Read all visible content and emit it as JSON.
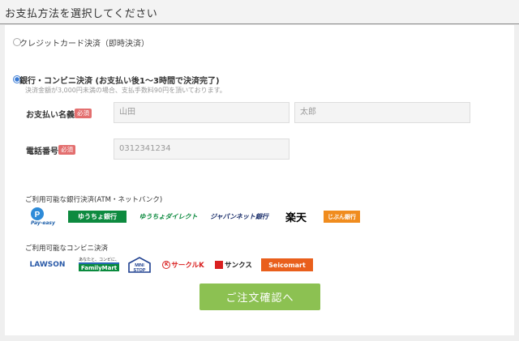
{
  "header": {
    "title": "お支払方法を選択してください"
  },
  "options": {
    "card_label": "クレジットカード決済（即時決済）",
    "bank_label": "銀行・コンビニ決済 (お支払い後1〜3時間で決済完了)",
    "bank_note": "決済金額が3,000円未満の場合、支払手数料90円を頂いております。"
  },
  "form": {
    "name_label": "お支払い名義",
    "phone_label": "電話番号",
    "required_badge": "必須",
    "last_name_placeholder": "山田",
    "first_name_placeholder": "太郎",
    "phone_placeholder": "0312341234"
  },
  "banks": {
    "title": "ご利用可能な銀行決済(ATM・ネットバンク)",
    "logos": [
      "Pay-easy",
      "ゆうちょ銀行",
      "ゆうちょダイレクト",
      "ジャパンネット銀行",
      "楽天",
      "じぶん銀行"
    ]
  },
  "convenience": {
    "title": "ご利用可能なコンビニ決済",
    "logos": [
      "LAWSON",
      "FamilyMart",
      "MINI STOP",
      "サークルK",
      "サンクス",
      "Seicomart"
    ],
    "familymart_tagline": "あなたと、コンビに、"
  },
  "submit_label": "ご注文確認へ"
}
